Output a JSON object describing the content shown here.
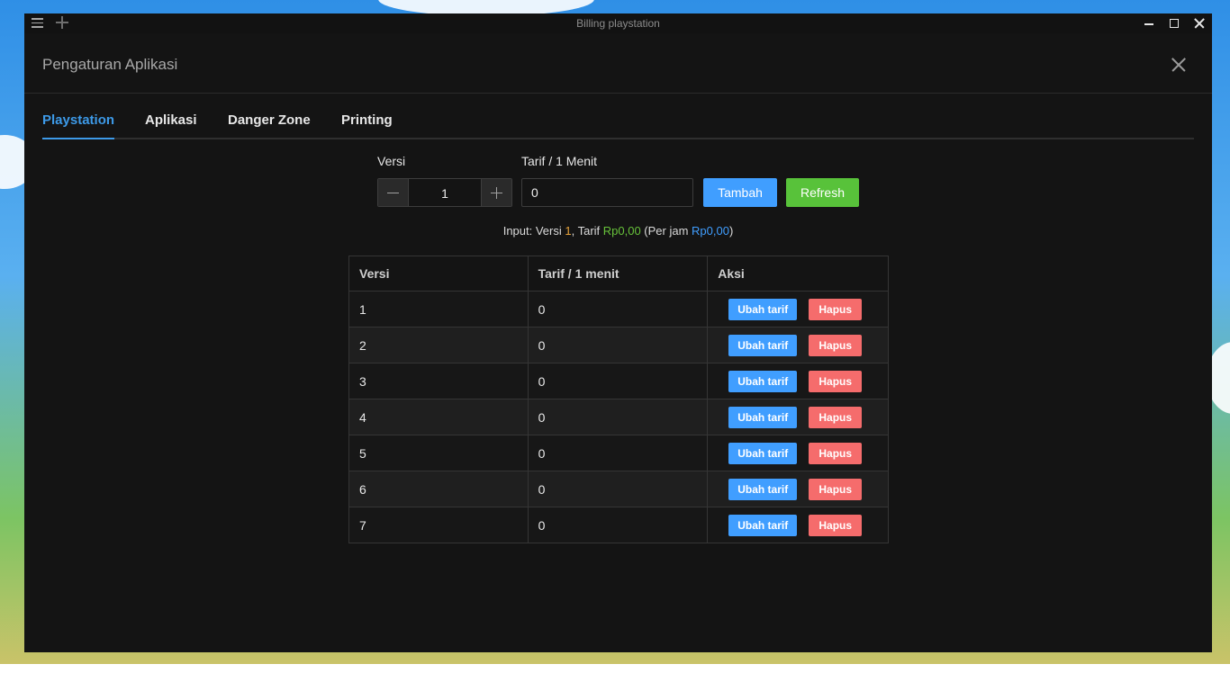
{
  "window": {
    "title": "Billing playstation"
  },
  "dialog": {
    "title": "Pengaturan Aplikasi"
  },
  "tabs": [
    {
      "label": "Playstation",
      "active": true
    },
    {
      "label": "Aplikasi",
      "active": false
    },
    {
      "label": "Danger Zone",
      "active": false
    },
    {
      "label": "Printing",
      "active": false
    }
  ],
  "form": {
    "versi_label": "Versi",
    "versi_value": "1",
    "tarif_label": "Tarif / 1 Menit",
    "tarif_value": "0",
    "tambah_label": "Tambah",
    "refresh_label": "Refresh"
  },
  "summary": {
    "prefix": "Input: Versi ",
    "versi": "1",
    "tarif_text": ", Tarif ",
    "tarif": "Rp0,00",
    "perjam_text": " (Per jam ",
    "perjam": "Rp0,00",
    "suffix": ")"
  },
  "table": {
    "headers": [
      "Versi",
      "Tarif / 1 menit",
      "Aksi"
    ],
    "edit_label": "Ubah tarif",
    "delete_label": "Hapus",
    "rows": [
      {
        "versi": "1",
        "tarif": "0"
      },
      {
        "versi": "2",
        "tarif": "0"
      },
      {
        "versi": "3",
        "tarif": "0"
      },
      {
        "versi": "4",
        "tarif": "0"
      },
      {
        "versi": "5",
        "tarif": "0"
      },
      {
        "versi": "6",
        "tarif": "0"
      },
      {
        "versi": "7",
        "tarif": "0"
      }
    ]
  },
  "colors": {
    "accent": "#409eff",
    "success": "#58c23a",
    "danger": "#f56c6c",
    "warning": "#e6a23c",
    "background": "#141414"
  },
  "icons": [
    "menu-icon",
    "plus-icon",
    "minimize-icon",
    "maximize-icon",
    "close-icon",
    "minus-icon"
  ]
}
